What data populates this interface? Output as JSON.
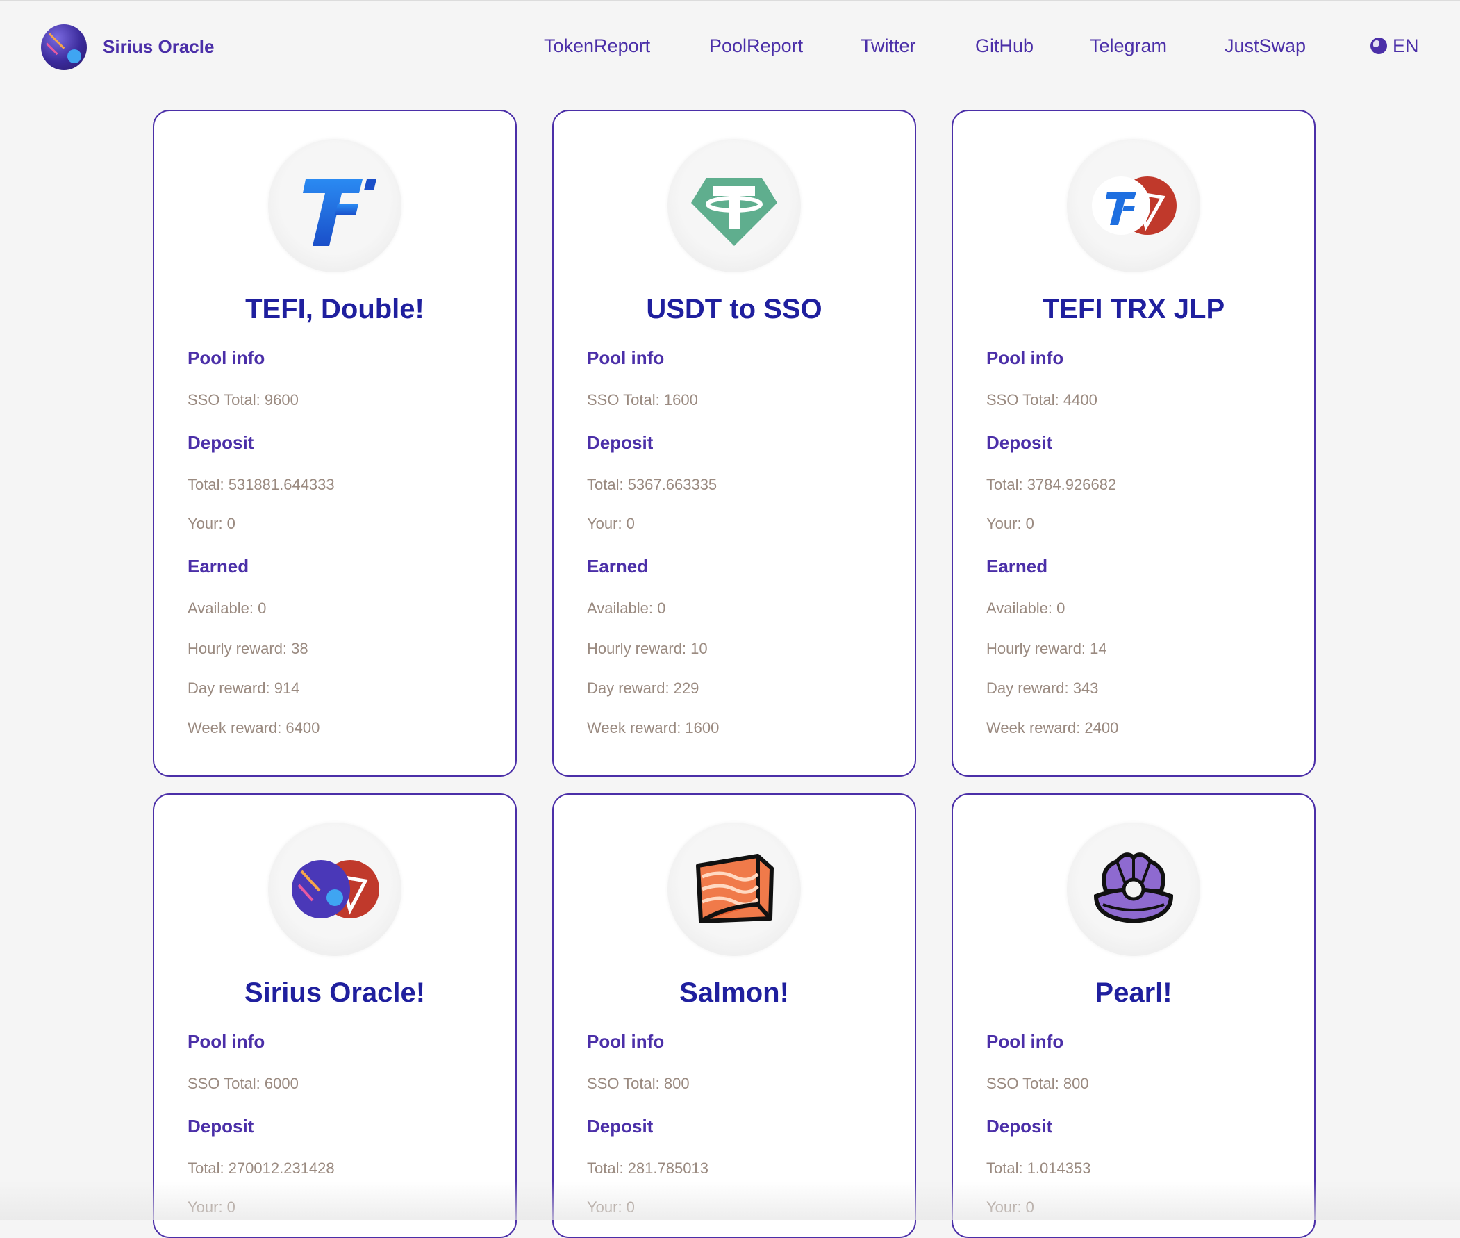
{
  "header": {
    "brand": "Sirius Oracle",
    "nav": [
      "TokenReport",
      "PoolReport",
      "Twitter",
      "GitHub",
      "Telegram",
      "JustSwap"
    ],
    "lang": "EN"
  },
  "labels": {
    "pool_info": "Pool info",
    "deposit": "Deposit",
    "earned": "Earned"
  },
  "cards": [
    {
      "icon": "tefi-logo-icon",
      "title": "TEFI, Double!",
      "sso_total": "SSO Total: 9600",
      "deposit_total": "Total: 531881.644333",
      "your": "Your: 0",
      "available": "Available: 0",
      "hourly": "Hourly reward: 38",
      "day": "Day reward: 914",
      "week": "Week reward: 6400"
    },
    {
      "icon": "usdt-logo-icon",
      "title": "USDT to SSO",
      "sso_total": "SSO Total: 1600",
      "deposit_total": "Total: 5367.663335",
      "your": "Your: 0",
      "available": "Available: 0",
      "hourly": "Hourly reward: 10",
      "day": "Day reward: 229",
      "week": "Week reward: 1600"
    },
    {
      "icon": "tefi-trx-pair-icon",
      "title": "TEFI TRX JLP",
      "sso_total": "SSO Total: 4400",
      "deposit_total": "Total: 3784.926682",
      "your": "Your: 0",
      "available": "Available: 0",
      "hourly": "Hourly reward: 14",
      "day": "Day reward: 343",
      "week": "Week reward: 2400"
    },
    {
      "icon": "sso-trx-pair-icon",
      "title": "Sirius Oracle!",
      "sso_total": "SSO Total: 6000",
      "deposit_total": "Total: 270012.231428",
      "your": "Your: 0"
    },
    {
      "icon": "salmon-icon",
      "title": "Salmon!",
      "sso_total": "SSO Total: 800",
      "deposit_total": "Total: 281.785013",
      "your": "Your: 0"
    },
    {
      "icon": "pearl-icon",
      "title": "Pearl!",
      "sso_total": "SSO Total: 800",
      "deposit_total": "Total: 1.014353",
      "your": "Your: 0"
    }
  ],
  "colors": {
    "accent": "#4b2fa8",
    "title": "#1f1f9e",
    "muted": "#9a8a80",
    "tefi_blue": "#1e6fe0",
    "usdt_green": "#5fae8e",
    "tron_red": "#c0392b",
    "salmon": "#f07a4a",
    "pearl_purple": "#8e6ad0"
  }
}
